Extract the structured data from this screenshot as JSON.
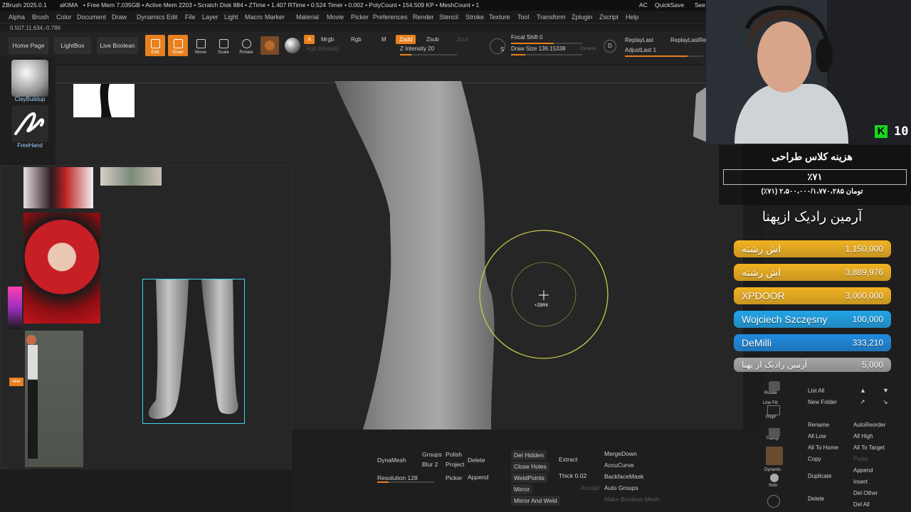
{
  "status_bar": {
    "app": "ZBrush 2025.0.1",
    "user": "aKIMA",
    "stats": "• Free Mem 7.035GB • Active Mem 2203 • Scratch Disk 884 • ZTime • 1.407 RTime • 0.524 Timer • 0.002 • PolyCount • 154.509 KP • MeshCount • 1",
    "ac": "AC",
    "quicksave": "QuickSave",
    "see": "See"
  },
  "menu": [
    "Alpha",
    "Brush",
    "Color",
    "Document",
    "Draw",
    "Dynamics",
    "Edit",
    "File",
    "Layer",
    "Light",
    "Macro",
    "Marker",
    "Material",
    "Movie",
    "Picker",
    "Preferences",
    "Render",
    "Stencil",
    "Stroke",
    "Texture",
    "Tool",
    "Transform",
    "Zplugin",
    "Zscript",
    "Help"
  ],
  "coords": "0.507,11.634,-0.786",
  "toolbar": {
    "home": "Home Page",
    "lightbox": "LightBox",
    "live_boolean": "Live Boolean",
    "tools": [
      "Edit",
      "Draw",
      "Move",
      "Scale",
      "Rotate"
    ],
    "a": "A",
    "mrgb": "Mrgb",
    "rgb": "Rgb",
    "m": "M",
    "zadd": "Zadd",
    "zsub": "Zsub",
    "zcut": "Zcut",
    "rgb_intensity": "Rgb Intensity",
    "z_intensity": "Z Intensity 20",
    "focal_shift": "Focal Shift 0",
    "draw_size": "Draw Size 136.15338",
    "dynamic": "Dynamic",
    "replay_last": "ReplayLast",
    "replay_last_rel": "ReplayLastRe",
    "adjust_last": "AdjustLast 1",
    "d": "D"
  },
  "left_panel": {
    "brush1": "ClayBuildup",
    "brush2": "FreeHand"
  },
  "viewport": {
    "cursor_label": "+ZBRK"
  },
  "bottom_panel": {
    "dynamesh": "DynaMesh",
    "groups": "Groups",
    "polish": "Polish",
    "blur": "Blur 2",
    "project": "Project",
    "resolution": "Resolution 128",
    "delete": "Delete",
    "append": "Append",
    "picker": "Picker",
    "del_hidden": "Del Hidden",
    "close_holes": "Close Holes",
    "weldpoints": "WeldPoints",
    "mirror": "Mirror",
    "mirror_weld": "Mirror And Weld",
    "extract": "Extract",
    "thick": "Thick 0.02",
    "accept": "Accept",
    "mergedown": "MergeDown",
    "accucurve": "AccuCurve",
    "backfacemask": "BackfaceMask",
    "autogroups": "Auto Groups",
    "make_boolean": "Make Boolean Mesh"
  },
  "right_panel": {
    "list_all": "List All",
    "new_folder": "New Folder",
    "rename": "Rename",
    "auto_reorder": "AutoReorder",
    "all_low": "All Low",
    "all_high": "All High",
    "all_to_home": "All To Home",
    "all_to_target": "All To Target",
    "copy": "Copy",
    "paste": "Paste",
    "duplicate": "Duplicate",
    "append": "Append",
    "insert": "Insert",
    "delete": "Delete",
    "del_other": "Del Other",
    "del_all": "Del All",
    "rotate": "Rotate",
    "line_fill": "Line Fill",
    "polyf": "PolyF",
    "transp": "Transp",
    "dynamic": "Dynamic",
    "solo": "Solo"
  },
  "overlay": {
    "goal_title": "هزینه کلاس طراحی",
    "goal_percent": "٪۷۱",
    "goal_amounts": "(٪۷۱) ۲،۵۰۰،۰۰۰/۱،۷۷۰،۲۸۵ تومان",
    "top_donor": "آرمین رادیک ازپهنا",
    "donations": [
      {
        "name": "اش رشته",
        "amount": "1,150,000",
        "color": "#f2b322"
      },
      {
        "name": "اش رشته",
        "amount": "3,889,976",
        "color": "#f2b322"
      },
      {
        "name": "XPDOOR",
        "amount": "3,000,000",
        "color": "#f2b322"
      },
      {
        "name": "Wojciech Szczęsny",
        "amount": "100,000",
        "color": "#21a4e8"
      },
      {
        "name": "DeMilli",
        "amount": "333,210",
        "color": "#1f8be0"
      },
      {
        "name": "آرمین رادیک از پهنا",
        "amount": "5,000",
        "color": "#a6a6a6"
      }
    ]
  },
  "webcam": {
    "badge": "10"
  }
}
